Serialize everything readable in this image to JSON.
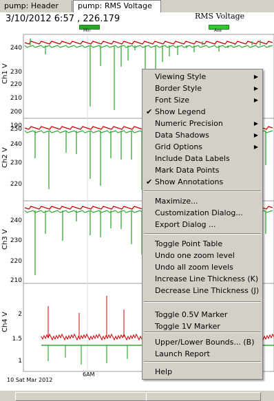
{
  "tabs": [
    {
      "label": "pump: Header"
    },
    {
      "label": "pump: RMS Voltage"
    }
  ],
  "header": {
    "readout": "3/10/2012 6:57 , 226.179",
    "legend_title": "RMS Voltage",
    "legend_min": "Min",
    "legend_ave": "Ave"
  },
  "panels": [
    {
      "ylabel": "Ch1 V",
      "ticks": [
        "240",
        "230",
        "220",
        "210",
        "200",
        "190"
      ]
    },
    {
      "ylabel": "Ch2 V",
      "ticks": [
        "250",
        "240",
        "230",
        "220"
      ]
    },
    {
      "ylabel": "Ch3 V",
      "ticks": [
        "240",
        "230",
        "220",
        "210"
      ]
    },
    {
      "ylabel": "Ch4 V",
      "ticks": [
        "2",
        "1.5",
        "1"
      ]
    }
  ],
  "xaxis": {
    "date_label": "10 Sat Mar 2012",
    "tick_6am": "6AM"
  },
  "colors": {
    "red": "#cc0000",
    "green": "#33aa33"
  },
  "menu": {
    "items": [
      {
        "label": "Viewing Style",
        "submenu": true,
        "checked": false
      },
      {
        "label": "Border Style",
        "submenu": true,
        "checked": false
      },
      {
        "label": "Font Size",
        "submenu": true,
        "checked": false
      },
      {
        "label": "Show Legend",
        "submenu": false,
        "checked": true
      },
      {
        "label": "Numeric Precision",
        "submenu": true,
        "checked": false
      },
      {
        "label": "Data Shadows",
        "submenu": true,
        "checked": false
      },
      {
        "label": "Grid Options",
        "submenu": true,
        "checked": false
      },
      {
        "label": "Include Data Labels",
        "submenu": false,
        "checked": false
      },
      {
        "label": "Mark Data Points",
        "submenu": false,
        "checked": false
      },
      {
        "label": "Show Annotations",
        "submenu": false,
        "checked": true
      },
      {
        "label": "Maximize...",
        "submenu": false,
        "checked": false
      },
      {
        "label": "Customization Dialog...",
        "submenu": false,
        "checked": false
      },
      {
        "label": "Export Dialog ...",
        "submenu": false,
        "checked": false
      },
      {
        "label": "Toggle Point Table",
        "submenu": false,
        "checked": false
      },
      {
        "label": "Undo one zoom level",
        "submenu": false,
        "checked": false
      },
      {
        "label": "Undo all zoom levels",
        "submenu": false,
        "checked": false
      },
      {
        "label": "Increase Line Thickness (K)",
        "submenu": false,
        "checked": false
      },
      {
        "label": "Decrease Line Thickness (J)",
        "submenu": false,
        "checked": false
      },
      {
        "label": "Toggle 0.5V Marker",
        "submenu": false,
        "checked": false
      },
      {
        "label": "Toggle 1V Marker",
        "submenu": false,
        "checked": false
      },
      {
        "label": "Upper/Lower Bounds... (B)",
        "submenu": false,
        "checked": false
      },
      {
        "label": "Launch Report",
        "submenu": false,
        "checked": false
      },
      {
        "label": "Help",
        "submenu": false,
        "checked": false
      }
    ]
  }
}
